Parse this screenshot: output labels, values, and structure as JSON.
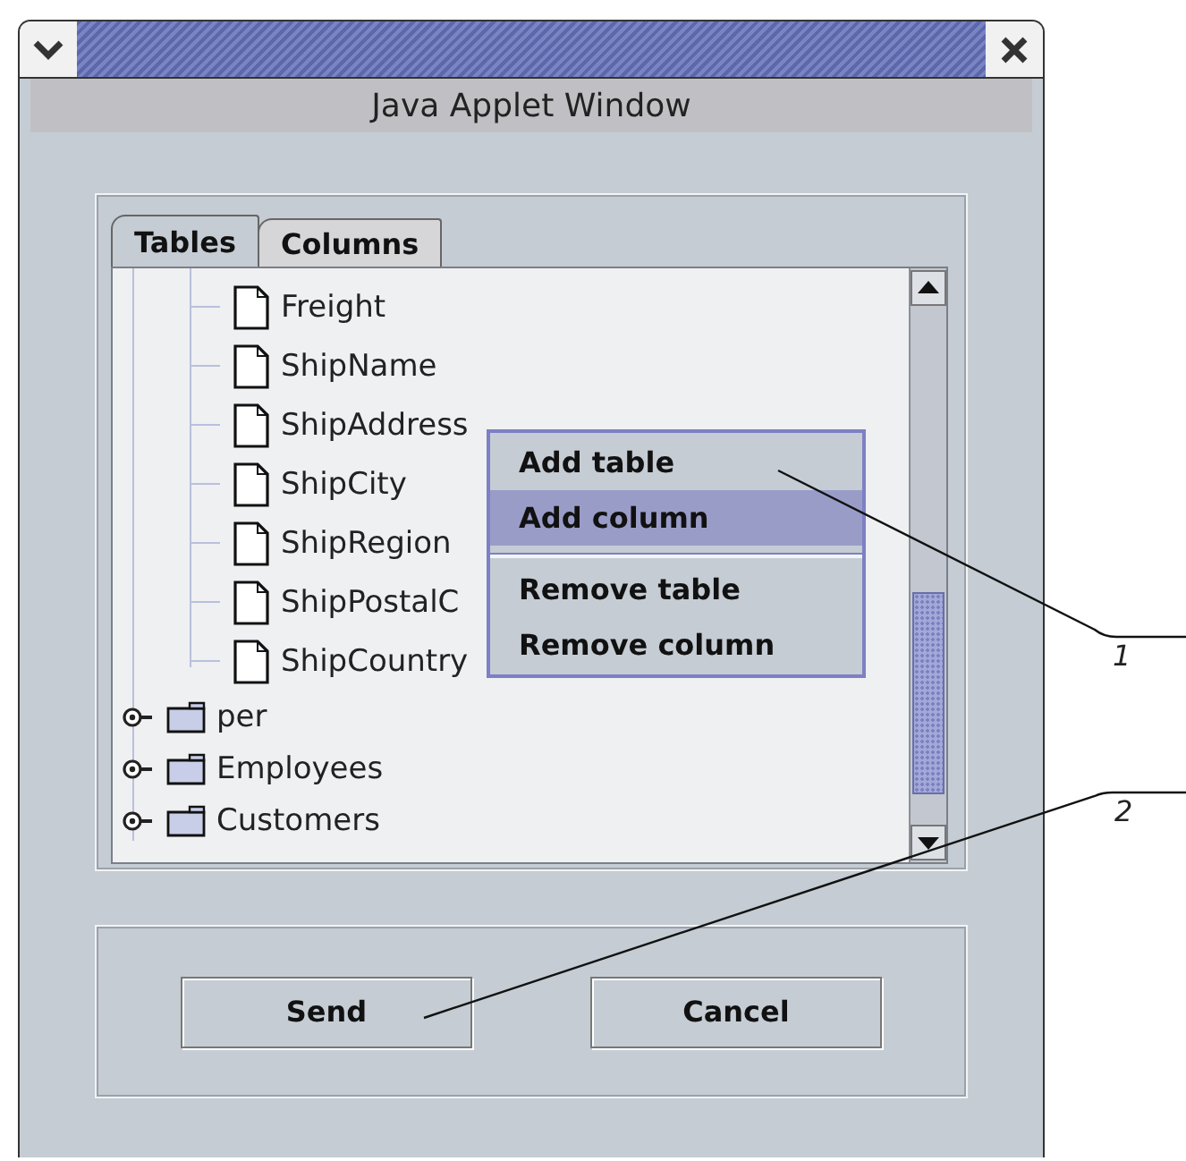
{
  "window": {
    "title": "Java Applet Window"
  },
  "tabs": [
    {
      "label": "Tables",
      "selected": true
    },
    {
      "label": "Columns",
      "selected": false
    }
  ],
  "tree": {
    "items": [
      {
        "kind": "column",
        "label": "Freight"
      },
      {
        "kind": "column",
        "label": "ShipName"
      },
      {
        "kind": "column",
        "label": "ShipAddress"
      },
      {
        "kind": "column",
        "label": "ShipCity"
      },
      {
        "kind": "column",
        "label": "ShipRegion"
      },
      {
        "kind": "column",
        "label": "ShipPostalC"
      },
      {
        "kind": "column",
        "label": "ShipCountry"
      },
      {
        "kind": "table",
        "label": "per",
        "expanded": false
      },
      {
        "kind": "table",
        "label": "Employees",
        "expanded": false
      },
      {
        "kind": "table",
        "label": "Customers",
        "expanded": false
      }
    ]
  },
  "context_menu": {
    "items": [
      {
        "kind": "item",
        "label": "Add table",
        "selected": false
      },
      {
        "kind": "item",
        "label": "Add column",
        "selected": true
      },
      {
        "kind": "separator"
      },
      {
        "kind": "item",
        "label": "Remove table",
        "selected": false
      },
      {
        "kind": "item",
        "label": "Remove column",
        "selected": false
      }
    ]
  },
  "buttons": [
    "Send",
    "Cancel"
  ],
  "callouts": [
    {
      "label": "1"
    },
    {
      "label": "2"
    }
  ]
}
